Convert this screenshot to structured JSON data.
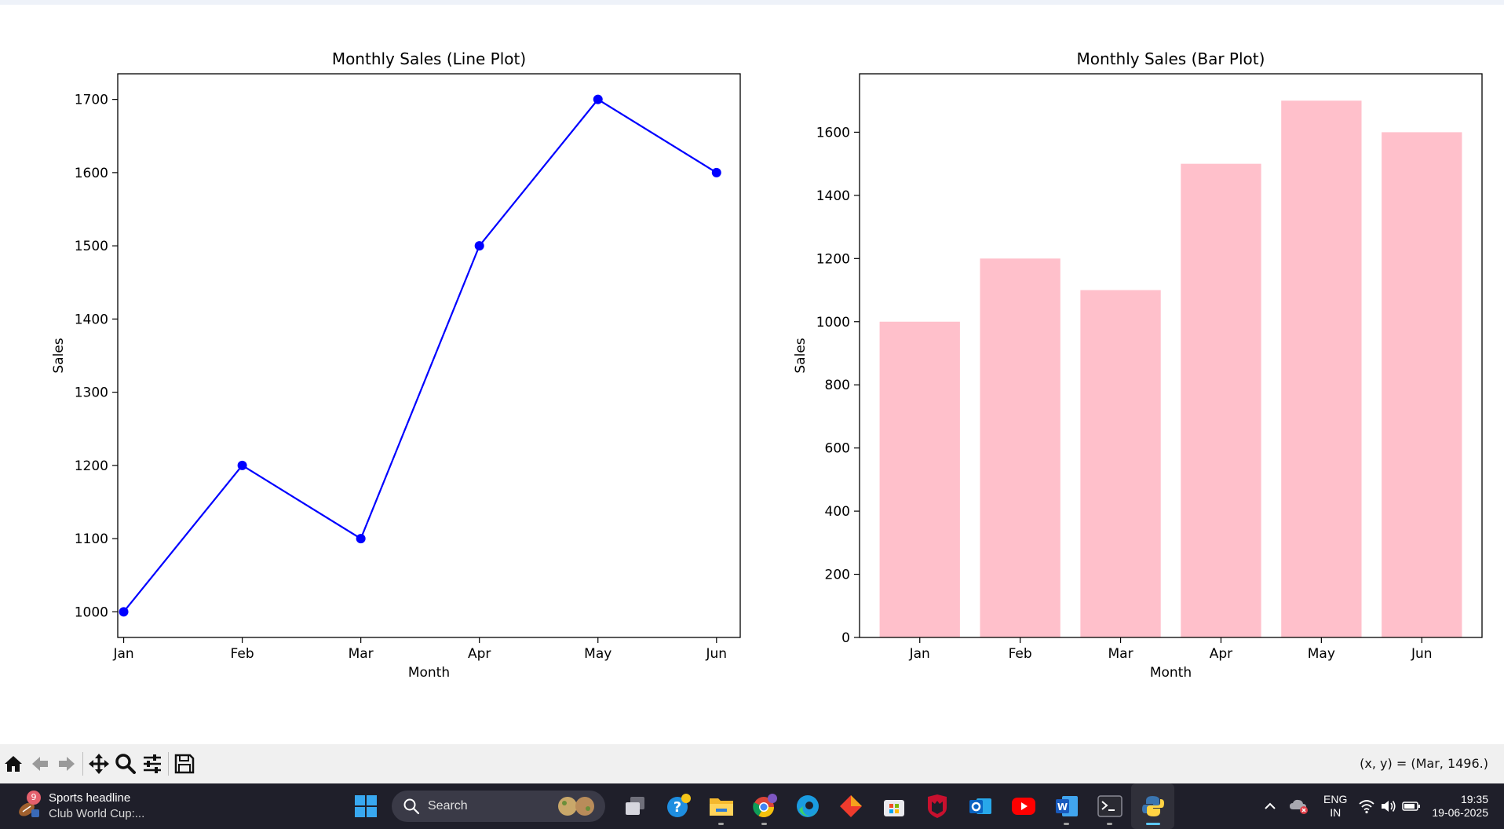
{
  "chart_data": [
    {
      "type": "line",
      "title": "Monthly Sales (Line Plot)",
      "xlabel": "Month",
      "ylabel": "Sales",
      "categories": [
        "Jan",
        "Feb",
        "Mar",
        "Apr",
        "May",
        "Jun"
      ],
      "values": [
        1000,
        1200,
        1100,
        1500,
        1700,
        1600
      ],
      "ylim": [
        965,
        1735
      ],
      "yticks": [
        "1000",
        "1100",
        "1200",
        "1300",
        "1400",
        "1500",
        "1600",
        "1700"
      ],
      "color": "#0000ff",
      "marker": "o",
      "grid": false
    },
    {
      "type": "bar",
      "title": "Monthly Sales (Bar Plot)",
      "xlabel": "Month",
      "ylabel": "Sales",
      "categories": [
        "Jan",
        "Feb",
        "Mar",
        "Apr",
        "May",
        "Jun"
      ],
      "values": [
        1000,
        1200,
        1100,
        1500,
        1700,
        1600
      ],
      "ylim": [
        0,
        1785
      ],
      "yticks": [
        "0",
        "200",
        "400",
        "600",
        "800",
        "1000",
        "1200",
        "1400",
        "1600"
      ],
      "color": "#ffc0cb",
      "grid": false
    }
  ],
  "toolbar": {
    "buttons": [
      "home-icon",
      "back-icon",
      "forward-icon",
      "pan-icon",
      "zoom-icon",
      "configure-icon",
      "save-icon"
    ],
    "coordinates": "(x, y) = (Mar, 1496.)"
  },
  "taskbar": {
    "widget": {
      "badge": "9",
      "title": "Sports headline",
      "subtitle": "Club World Cup:..."
    },
    "search": {
      "label": "Search"
    },
    "apps": [
      "windows-start-icon",
      "task-view-icon",
      "help-icon",
      "file-explorer-icon",
      "chrome-icon",
      "edge-icon",
      "git-icon",
      "store-icon",
      "mcafee-icon",
      "outlook-icon",
      "youtube-icon",
      "word-icon",
      "terminal-icon",
      "python-icon"
    ],
    "language": {
      "line1": "ENG",
      "line2": "IN"
    },
    "clock": {
      "time": "19:35",
      "date": "19-06-2025"
    }
  },
  "colors": {
    "taskbar": "#1f1f2a",
    "toolbar": "#f0f0f0"
  }
}
